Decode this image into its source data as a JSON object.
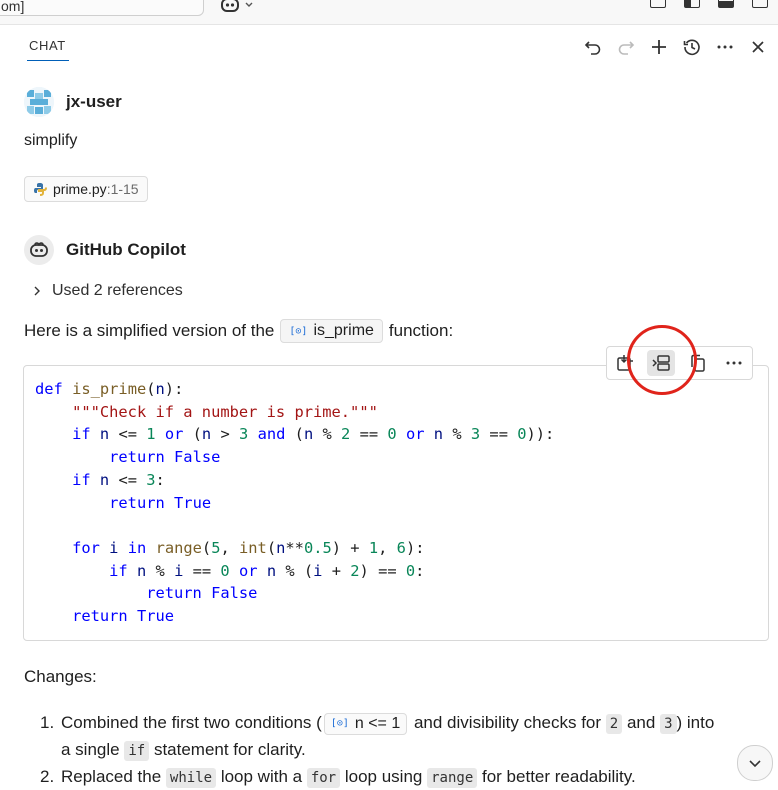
{
  "topbar": {
    "search_text": "om]"
  },
  "header": {
    "tab_label": "CHAT"
  },
  "user": {
    "name": "jx-user",
    "message": "simplify",
    "attachment": {
      "file": "prime.py",
      "range": ":1-15"
    }
  },
  "assistant": {
    "name": "GitHub Copilot",
    "references_label": "Used 2 references",
    "intro_before": "Here is a simplified version of the",
    "symbol": "is_prime",
    "intro_after": "function:",
    "symbol_icon_text": "[⊙]"
  },
  "code": {
    "lines": [
      "def is_prime(n):",
      "    \"\"\"Check if a number is prime.\"\"\"",
      "    if n <= 1 or (n > 3 and (n % 2 == 0 or n % 3 == 0)):",
      "        return False",
      "    if n <= 3:",
      "        return True",
      "",
      "    for i in range(5, int(n**0.5) + 1, 6):",
      "        if n % i == 0 or n % (i + 2) == 0:",
      "            return False",
      "    return True"
    ]
  },
  "changes": {
    "title": "Changes:",
    "item1": {
      "num": "1.",
      "t1": "Combined the first two conditions (",
      "chip": "n <= 1",
      "t2": "and divisibility checks for",
      "c2": "2",
      "t3": "and",
      "c3": "3",
      "t4": ") into",
      "t5": "a single",
      "c_if": "if",
      "t6": "statement for clarity."
    },
    "item2": {
      "num": "2.",
      "t1": "Replaced the",
      "c_while": "while",
      "t2": "loop with a",
      "c_for": "for",
      "t3": "loop using",
      "c_range": "range",
      "t4": "for better readability."
    }
  },
  "colors": {
    "highlight": "#e0241b",
    "accent": "#005fb8"
  }
}
